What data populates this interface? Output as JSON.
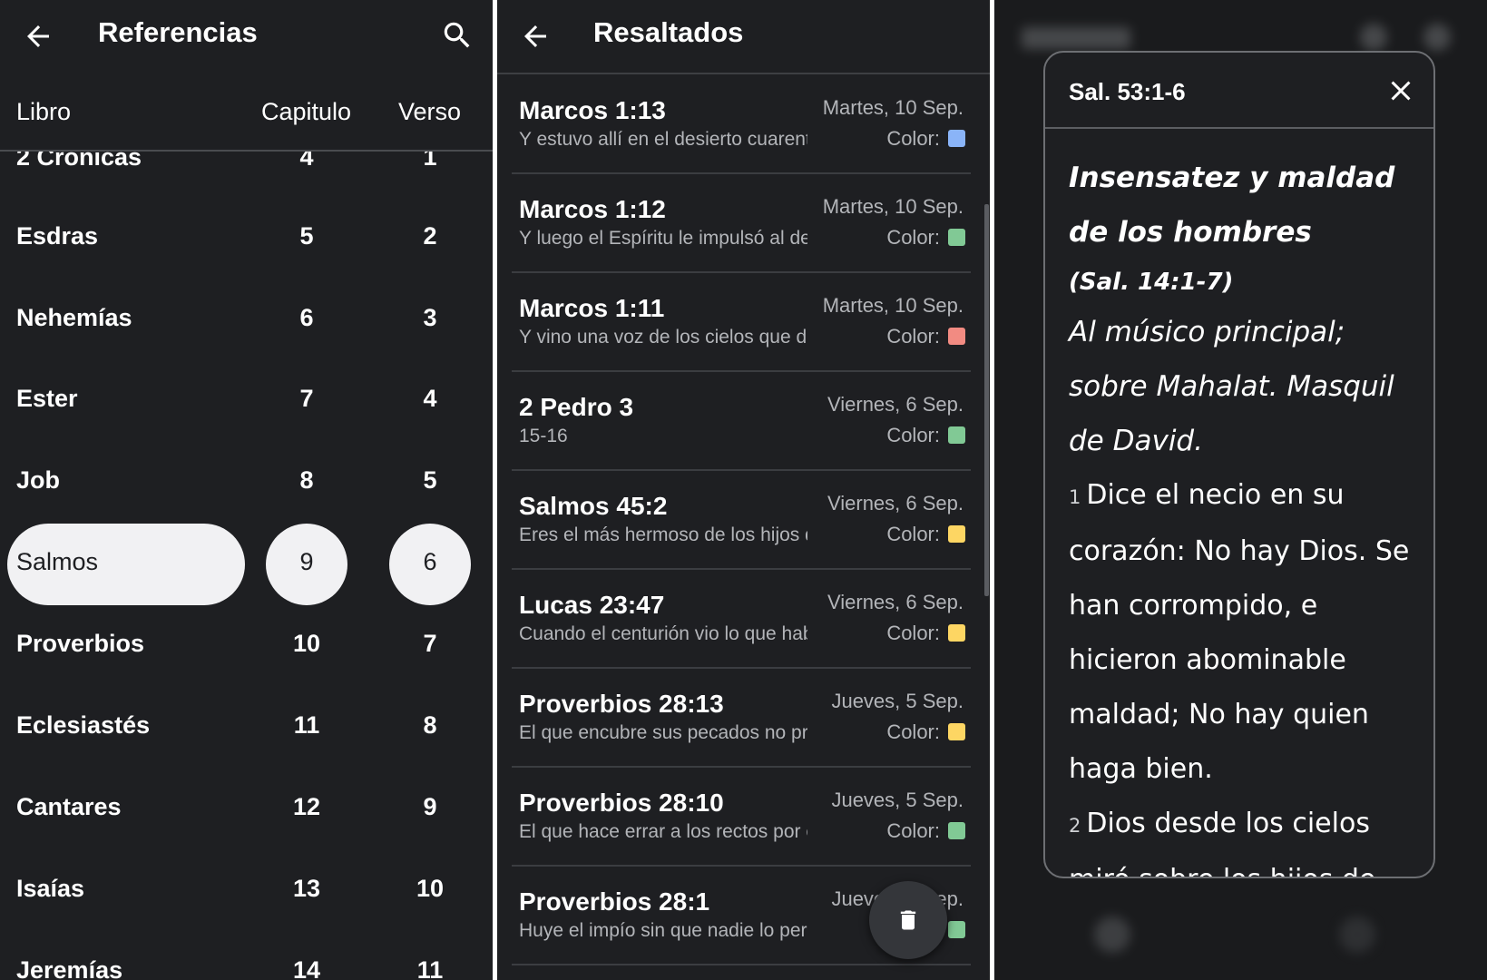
{
  "references": {
    "title": "Referencias",
    "columns": {
      "book": "Libro",
      "chapter": "Capitulo",
      "verse": "Verso"
    },
    "rows": [
      {
        "book": "2 Crónicas",
        "chapter": "4",
        "verse": "1"
      },
      {
        "book": "Esdras",
        "chapter": "5",
        "verse": "2"
      },
      {
        "book": "Nehemías",
        "chapter": "6",
        "verse": "3"
      },
      {
        "book": "Ester",
        "chapter": "7",
        "verse": "4"
      },
      {
        "book": "Job",
        "chapter": "8",
        "verse": "5"
      },
      {
        "book": "Salmos",
        "chapter": "9",
        "verse": "6"
      },
      {
        "book": "Proverbios",
        "chapter": "10",
        "verse": "7"
      },
      {
        "book": "Eclesiastés",
        "chapter": "11",
        "verse": "8"
      },
      {
        "book": "Cantares",
        "chapter": "12",
        "verse": "9"
      },
      {
        "book": "Isaías",
        "chapter": "13",
        "verse": "10"
      },
      {
        "book": "Jeremías",
        "chapter": "14",
        "verse": "11"
      }
    ]
  },
  "highlights": {
    "title": "Resaltados",
    "color_label": "Color:",
    "items": [
      {
        "ref": "Marcos 1:13",
        "snippet": "Y estuvo allí en el desierto cuarenta días",
        "date": "Martes, 10 Sep.",
        "color": "#8ab4f8"
      },
      {
        "ref": "Marcos 1:12",
        "snippet": "Y luego el Espíritu le impulsó al desierto",
        "date": "Martes, 10 Sep.",
        "color": "#81c995"
      },
      {
        "ref": "Marcos 1:11",
        "snippet": "Y vino una voz de los cielos que decía",
        "date": "Martes, 10 Sep.",
        "color": "#f28b82"
      },
      {
        "ref": "2 Pedro 3",
        "snippet": "15-16",
        "date": "Viernes, 6 Sep.",
        "color": "#81c995"
      },
      {
        "ref": "Salmos 45:2",
        "snippet": "Eres el más hermoso de los hijos de los hombres",
        "date": "Viernes, 6 Sep.",
        "color": "#fdd663"
      },
      {
        "ref": "Lucas 23:47",
        "snippet": "Cuando el centurión vio lo que había acontecido",
        "date": "Viernes, 6 Sep.",
        "color": "#fdd663"
      },
      {
        "ref": "Proverbios 28:13",
        "snippet": "El que encubre sus pecados no prosperará",
        "date": "Jueves, 5 Sep.",
        "color": "#fdd663"
      },
      {
        "ref": "Proverbios 28:10",
        "snippet": "El que hace errar a los rectos por el mal camino",
        "date": "Jueves, 5 Sep.",
        "color": "#81c995"
      },
      {
        "ref": "Proverbios 28:1",
        "snippet": "Huye el impío sin que nadie lo persiga",
        "date": "Jueves, 5 Sep.",
        "color": "#81c995"
      }
    ]
  },
  "passage": {
    "ref": "Sal. 53:1-6",
    "heading": "Insensatez y maldad de los hombres",
    "xref": "(Sal. 14:1-7)",
    "superscription": "Al músico principal; sobre Mahalat. Masquil de David.",
    "verses": [
      {
        "n": "1",
        "text": "Dice el necio en su corazón: No hay Dios. Se han corrompido, e hicieron abominable maldad; No hay quien haga bien."
      },
      {
        "n": "2",
        "text": "Dios desde los cielos miró sobre los hijos de los hombres,"
      }
    ]
  },
  "icons": {
    "back": "arrow-left-icon",
    "search": "search-icon",
    "close": "close-icon",
    "delete": "trash-icon"
  }
}
